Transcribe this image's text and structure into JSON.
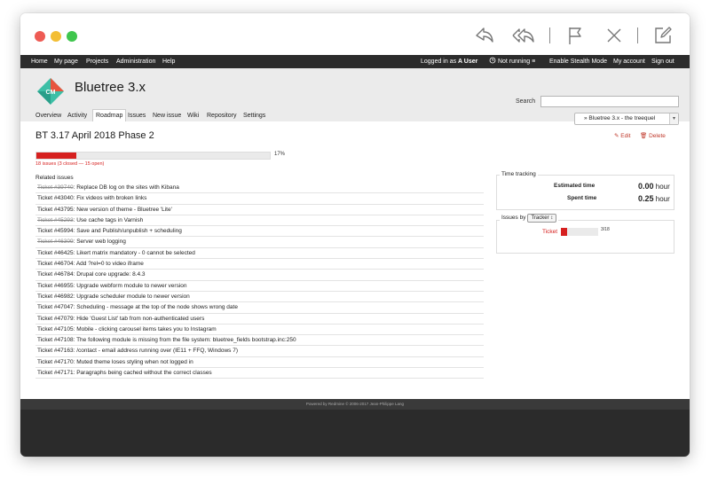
{
  "toolbar_icons": [
    "reply-icon",
    "reply-all-icon",
    "flag-icon",
    "close-icon",
    "compose-icon"
  ],
  "topmenu": {
    "left": [
      "Home",
      "My page",
      "Projects",
      "Administration",
      "Help"
    ],
    "logged_in_prefix": "Logged in as",
    "user": "A User",
    "status": "Not running",
    "stealth": "Enable Stealth Mode",
    "my_account": "My account",
    "sign_out": "Sign out"
  },
  "header": {
    "logo_text": "CM",
    "project": "Bluetree 3.x",
    "search_label": "Search",
    "jump": "» Bluetree 3.x - the treequel"
  },
  "tabs": [
    "Overview",
    "Activity",
    "Roadmap",
    "Issues",
    "New issue",
    "Wiki",
    "Repository",
    "Settings"
  ],
  "active_tab": "Roadmap",
  "version": {
    "title": "BT 3.17 April 2018 Phase 2",
    "edit": "Edit",
    "delete": "Delete",
    "progress": 0.17,
    "progress_label": "17%",
    "legend": "18 issues   (3 closed — 15 open)",
    "related_title": "Related issues"
  },
  "issues": [
    {
      "id": "Ticket #39740",
      "title": ": Replace DB log on the sites with Kibana",
      "closed": true
    },
    {
      "id": "Ticket #43040",
      "title": ": Fix videos with broken links",
      "closed": false
    },
    {
      "id": "Ticket #43795",
      "title": ": New version of theme - Bluetree 'Lite'",
      "closed": false
    },
    {
      "id": "Ticket #45293",
      "title": ": Use cache tags in Varnish",
      "closed": true
    },
    {
      "id": "Ticket #45994",
      "title": ": Save and Publish/unpublish + scheduling",
      "closed": false
    },
    {
      "id": "Ticket #46309",
      "title": ": Server web logging",
      "closed": true
    },
    {
      "id": "Ticket #46425",
      "title": ": Likert matrix mandatory - 0 cannot be selected",
      "closed": false
    },
    {
      "id": "Ticket #46704",
      "title": ": Add ?rel=0 to video iframe",
      "closed": false
    },
    {
      "id": "Ticket #46784",
      "title": ": Drupal core upgrade: 8.4.3",
      "closed": false
    },
    {
      "id": "Ticket #46955",
      "title": ": Upgrade webform module to newer version",
      "closed": false
    },
    {
      "id": "Ticket #46982",
      "title": ": Upgrade scheduler module to newer version",
      "closed": false
    },
    {
      "id": "Ticket #47047",
      "title": ": Scheduling - message at the top of the node shows wrong date",
      "closed": false
    },
    {
      "id": "Ticket #47079",
      "title": ": Hide 'Guest List' tab from non-authenticated users",
      "closed": false
    },
    {
      "id": "Ticket #47105",
      "title": ": Mobile - clicking carousel items takes you to Instagram",
      "closed": false
    },
    {
      "id": "Ticket #47108",
      "title": ": The following module is missing from the file system: bluetree_fields bootstrap.inc:250",
      "closed": false
    },
    {
      "id": "Ticket #47163",
      "title": ": /contact - email address running over (IE11 + FFQ, Windows 7)",
      "closed": false
    },
    {
      "id": "Ticket #47170",
      "title": ": Muted theme loses styling when not logged in",
      "closed": false
    },
    {
      "id": "Ticket #47171",
      "title": ": Paragraphs being cached without the correct classes",
      "closed": false
    }
  ],
  "time_tracking": {
    "legend": "Time tracking",
    "estimated_label": "Estimated time",
    "estimated_num": "0.00",
    "spent_label": "Spent time",
    "spent_num": "0.25",
    "unit": "hour"
  },
  "issues_by": {
    "legend": "Issues by",
    "select": "Tracker",
    "label": "Ticket",
    "fraction": 0.1667,
    "count": "3/18"
  },
  "footer": "Powered by Redmine © 2006-2017 Jean-Philippe Lang",
  "colors": {
    "accent": "#d6201f",
    "menu_bg": "#2c2c2c",
    "header_bg": "#ebebeb",
    "logo": "#3dbfa6"
  }
}
